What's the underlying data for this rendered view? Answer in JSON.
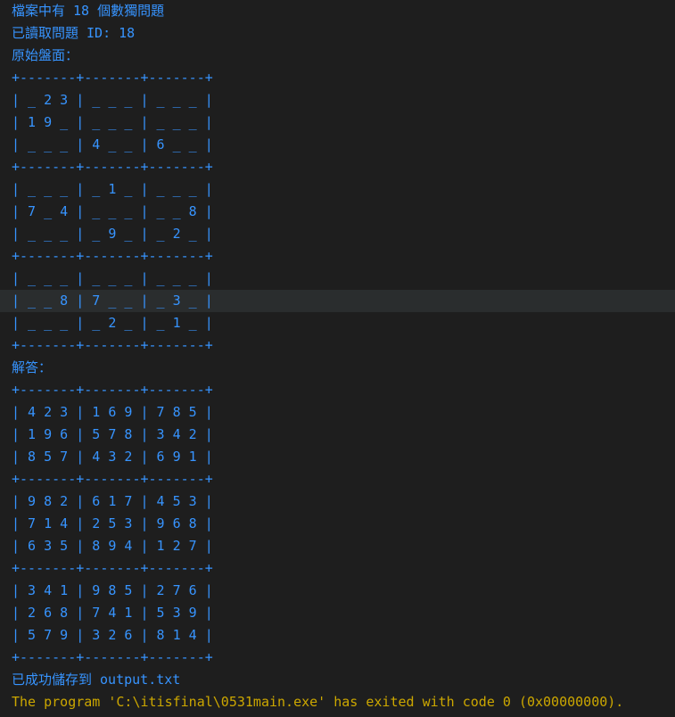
{
  "terminal": {
    "colors": {
      "background": "#1e1e1e",
      "output_text": "#3794ff",
      "exit_text": "#cca700",
      "highlight_row": "#2a2d2e"
    },
    "highlighted_line_index": 13,
    "lines": [
      "檔案中有 18 個數獨問題",
      "已讀取問題 ID: 18",
      "原始盤面：",
      "+-------+-------+-------+",
      "| _ 2 3 | _ _ _ | _ _ _ |",
      "| 1 9 _ | _ _ _ | _ _ _ |",
      "| _ _ _ | 4 _ _ | 6 _ _ |",
      "+-------+-------+-------+",
      "| _ _ _ | _ 1 _ | _ _ _ |",
      "| 7 _ 4 | _ _ _ | _ _ 8 |",
      "| _ _ _ | _ 9 _ | _ 2 _ |",
      "+-------+-------+-------+",
      "| _ _ _ | _ _ _ | _ _ _ |",
      "| _ _ 8 | 7 _ _ | _ 3 _ |",
      "| _ _ _ | _ 2 _ | _ 1 _ |",
      "+-------+-------+-------+",
      "解答：",
      "+-------+-------+-------+",
      "| 4 2 3 | 1 6 9 | 7 8 5 |",
      "| 1 9 6 | 5 7 8 | 3 4 2 |",
      "| 8 5 7 | 4 3 2 | 6 9 1 |",
      "+-------+-------+-------+",
      "| 9 8 2 | 6 1 7 | 4 5 3 |",
      "| 7 1 4 | 2 5 3 | 9 6 8 |",
      "| 6 3 5 | 8 9 4 | 1 2 7 |",
      "+-------+-------+-------+",
      "| 3 4 1 | 9 8 5 | 2 7 6 |",
      "| 2 6 8 | 7 4 1 | 5 3 9 |",
      "| 5 7 9 | 3 2 6 | 8 1 4 |",
      "+-------+-------+-------+",
      "已成功儲存到 output.txt",
      "The program 'C:\\itisfinal\\0531main.exe' has exited with code 0 (0x00000000)."
    ]
  }
}
